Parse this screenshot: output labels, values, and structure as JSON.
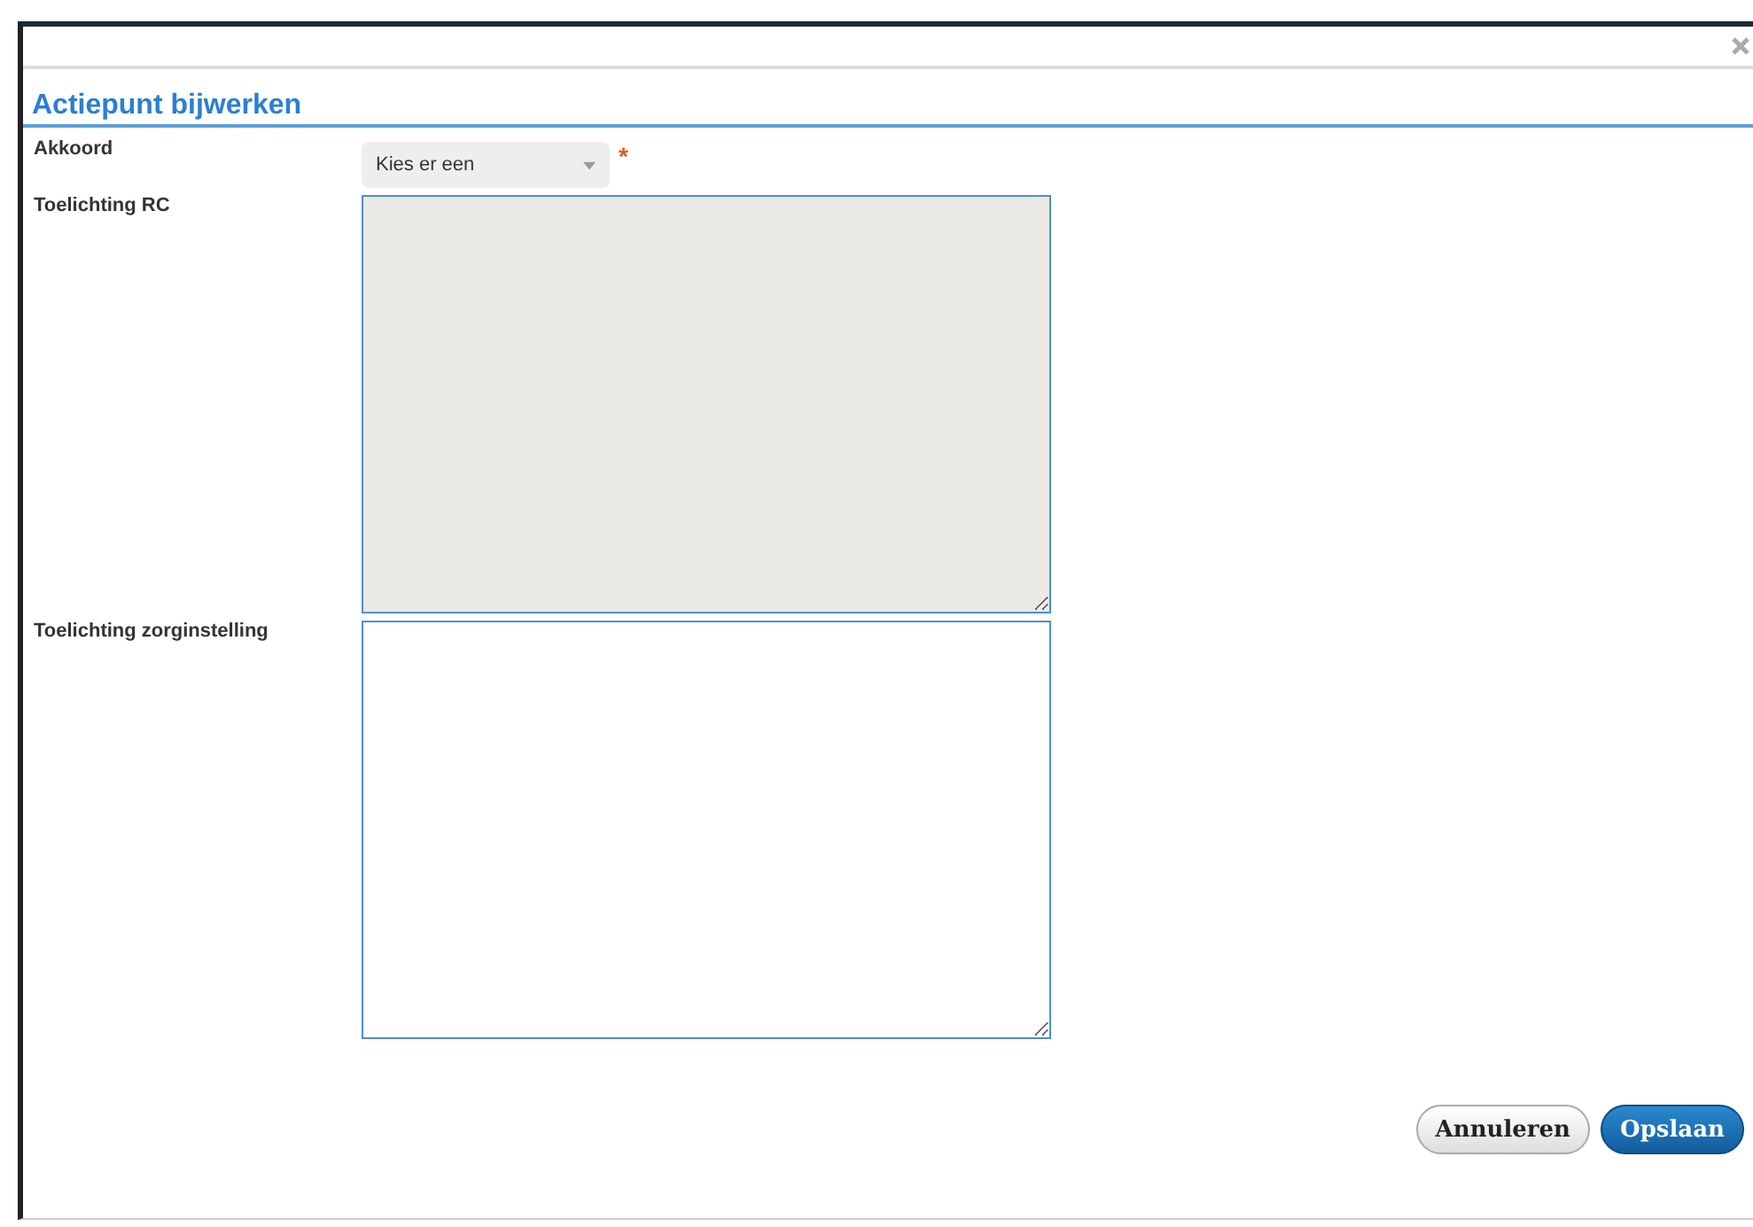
{
  "dialog": {
    "title": "Actiepunt bijwerken"
  },
  "fields": [
    {
      "kind": "select",
      "label": "Akkoord",
      "value": "Kies er een",
      "required_mark": "*"
    },
    {
      "kind": "textarea",
      "label": "Toelichting RC",
      "disabled": true
    },
    {
      "kind": "textarea",
      "label": "Toelichting zorginstelling",
      "disabled": false
    }
  ],
  "buttons": [
    {
      "label": "Annuleren",
      "primary": false
    },
    {
      "label": "Opslaan",
      "primary": true
    }
  ]
}
